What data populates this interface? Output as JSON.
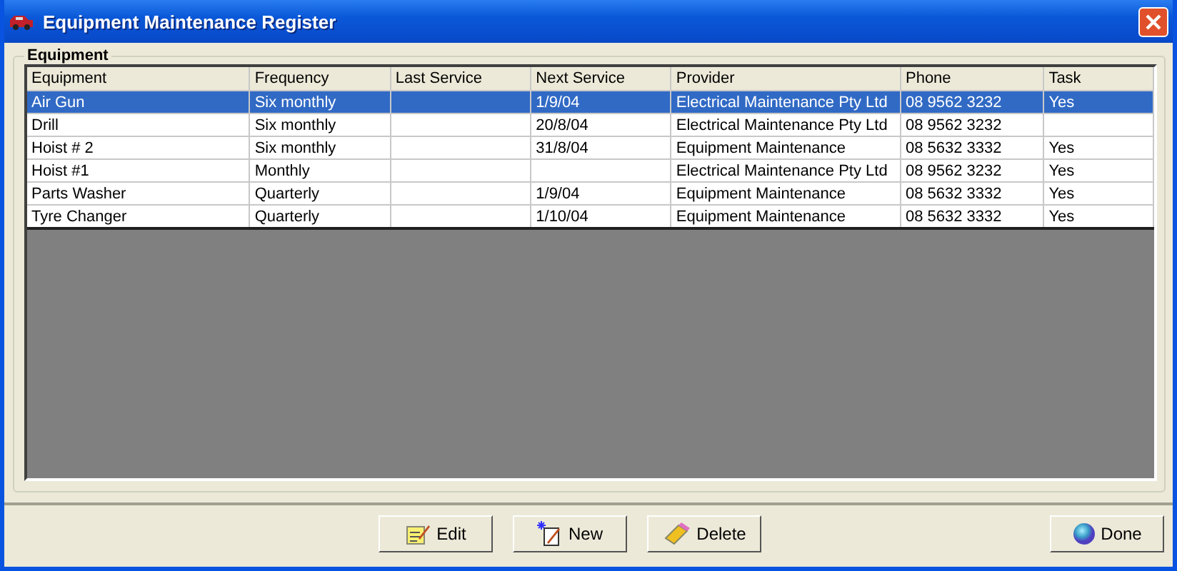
{
  "window": {
    "title": "Equipment Maintenance Register"
  },
  "group": {
    "label": "Equipment"
  },
  "table": {
    "columns": [
      "Equipment",
      "Frequency",
      "Last Service",
      "Next Service",
      "Provider",
      "Phone",
      "Task"
    ],
    "rows": [
      {
        "selected": true,
        "cells": [
          "Air Gun",
          "Six monthly",
          "",
          "1/9/04",
          "Electrical Maintenance Pty Ltd",
          "08 9562 3232",
          "Yes"
        ]
      },
      {
        "selected": false,
        "cells": [
          "Drill",
          "Six monthly",
          "",
          "20/8/04",
          "Electrical Maintenance Pty Ltd",
          "08 9562 3232",
          ""
        ]
      },
      {
        "selected": false,
        "cells": [
          "Hoist # 2",
          "Six monthly",
          "",
          "31/8/04",
          "Equipment Maintenance",
          "08 5632 3332",
          "Yes"
        ]
      },
      {
        "selected": false,
        "cells": [
          "Hoist #1",
          "Monthly",
          "",
          "",
          "Electrical Maintenance Pty Ltd",
          "08 9562 3232",
          "Yes"
        ]
      },
      {
        "selected": false,
        "cells": [
          "Parts Washer",
          "Quarterly",
          "",
          "1/9/04",
          "Equipment Maintenance",
          "08 5632 3332",
          "Yes"
        ]
      },
      {
        "selected": false,
        "cells": [
          "Tyre Changer",
          "Quarterly",
          "",
          "1/10/04",
          "Equipment Maintenance",
          "08 5632 3332",
          "Yes"
        ]
      }
    ]
  },
  "buttons": [
    {
      "kind": "edit",
      "label": "Edit"
    },
    {
      "kind": "new",
      "label": "New"
    },
    {
      "kind": "delete",
      "label": "Delete"
    }
  ],
  "done_button": {
    "label": "Done"
  }
}
